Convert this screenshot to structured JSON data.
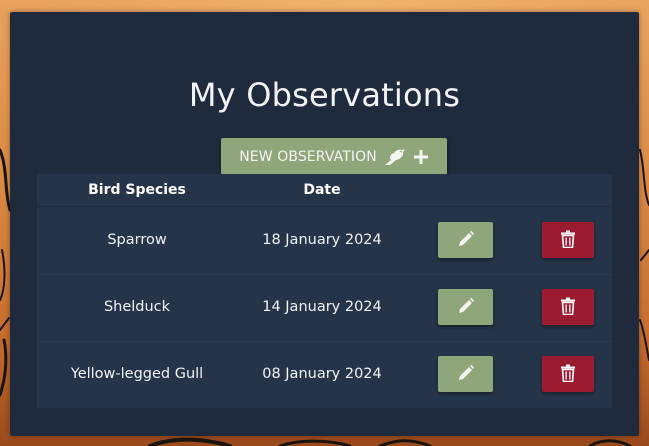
{
  "page": {
    "title": "My Observations"
  },
  "toolbar": {
    "new_observation_label": "NEW OBSERVATION",
    "new_observation_icons": [
      "bird-icon",
      "plus-icon"
    ]
  },
  "table": {
    "headers": [
      "Bird Species",
      "Date"
    ],
    "rows": [
      {
        "species": "Sparrow",
        "date": "18 January 2024"
      },
      {
        "species": "Shelduck",
        "date": "14 January 2024"
      },
      {
        "species": "Yellow-legged Gull",
        "date": "08 January 2024"
      }
    ],
    "row_actions": [
      "pencil-icon",
      "trash-icon"
    ]
  },
  "colors": {
    "panel": "#1f2b3c",
    "table": "#263449",
    "primary_button": "#8fa67b",
    "danger_button": "#9b1b30",
    "background_sky": "#db8a44"
  }
}
